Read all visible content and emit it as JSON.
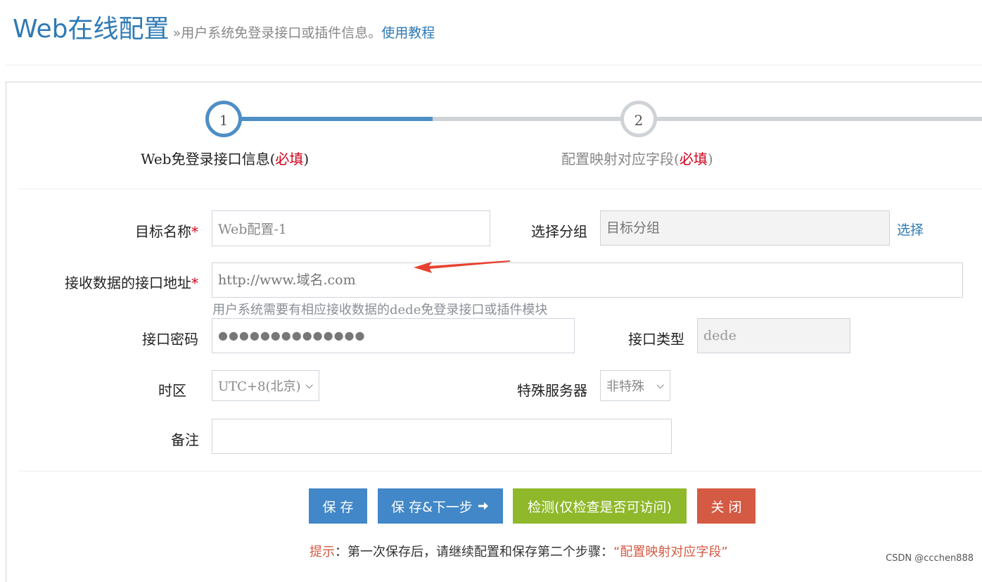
{
  "header": {
    "title": "Web在线配置",
    "subtitle": "»用户系统免登录接口或插件信息。",
    "tutorial_link": "使用教程"
  },
  "steps": [
    {
      "number": "1",
      "label": "Web免登录接口信息(",
      "required": "必填",
      "suffix": ")",
      "active": true
    },
    {
      "number": "2",
      "label": "配置映射对应字段(",
      "required": "必填",
      "suffix": ")",
      "active": false
    }
  ],
  "form": {
    "target_name": {
      "label": "目标名称",
      "required_mark": "*",
      "value": "Web配置-1"
    },
    "group": {
      "label": "选择分组",
      "placeholder": "目标分组",
      "pick_link": "选择"
    },
    "api_url": {
      "label": "接收数据的接口地址",
      "required_mark": "*",
      "placeholder": "http://www.域名.com",
      "help": "用户系统需要有相应接收数据的dede免登录接口或插件模块"
    },
    "api_password": {
      "label": "接口密码",
      "value": "●●●●●●●●●●●●●●"
    },
    "api_type": {
      "label": "接口类型",
      "value": "dede"
    },
    "timezone": {
      "label": "时区",
      "value": "UTC+8(北京)"
    },
    "special_server": {
      "label": "特殊服务器",
      "value": "非特殊"
    },
    "remark": {
      "label": "备注",
      "value": ""
    }
  },
  "buttons": {
    "save": "保 存",
    "save_next": "保 存&下一步",
    "check": "检测(仅检查是否可访问)",
    "close": "关 闭"
  },
  "tip": {
    "prefix": "提示",
    "text": "：第一次保存后，请继续配置和保存第二个步骤：",
    "highlight": "“配置映射对应字段”"
  },
  "watermark": "CSDN @ccchen888",
  "colors": {
    "accent": "#4e8ec5",
    "required": "#d0021b",
    "save": "#4287c7",
    "check": "#8fb82b",
    "close": "#d45a43"
  }
}
